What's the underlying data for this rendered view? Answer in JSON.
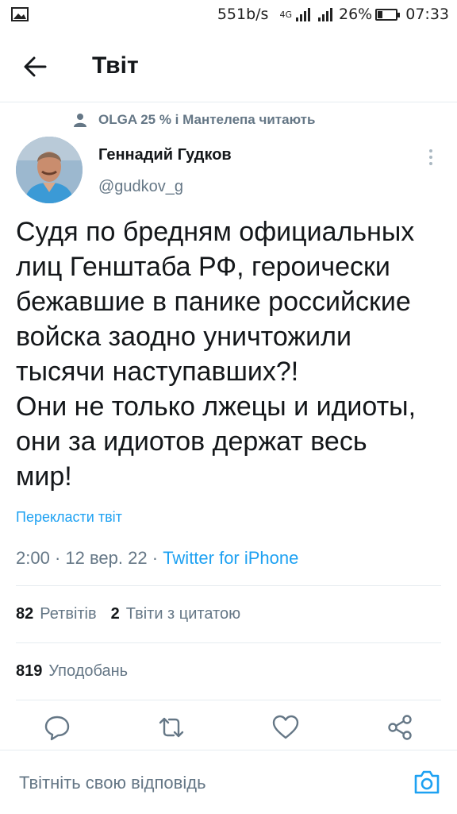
{
  "status_bar": {
    "speed": "551b/s",
    "network": "4G",
    "battery": "26%",
    "battery_level": 0.26,
    "time": "07:33"
  },
  "header": {
    "title": "Твіт"
  },
  "social_context": {
    "text": "OLGA 25 % і Мантелепа читають"
  },
  "author": {
    "name": "Геннадий Гудков",
    "handle": "@gudkov_g"
  },
  "tweet": {
    "text": "Судя по бредням официальных\nлиц Генштаба РФ, героически\nбежавшие в панике российские\nвойска заодно уничтожили\nтысячи наступавших?!\nОни не только лжецы и идиоты,\nони за идиотов держат весь\nмир!",
    "translate_label": "Перекласти твіт",
    "time": "2:00",
    "date": "12 вер. 22",
    "source": "Twitter for iPhone"
  },
  "stats": {
    "retweets_count": "82",
    "retweets_label": "Ретвітів",
    "quotes_count": "2",
    "quotes_label": "Твіти з цитатою",
    "likes_count": "819",
    "likes_label": "Уподобань"
  },
  "actions": [
    "reply-icon",
    "retweet-icon",
    "like-icon",
    "share-icon"
  ],
  "reply": {
    "placeholder": "Твітніть свою відповідь"
  },
  "colors": {
    "accent": "#1da1f2",
    "secondary_text": "#657786",
    "divider": "#e6ecf0"
  }
}
